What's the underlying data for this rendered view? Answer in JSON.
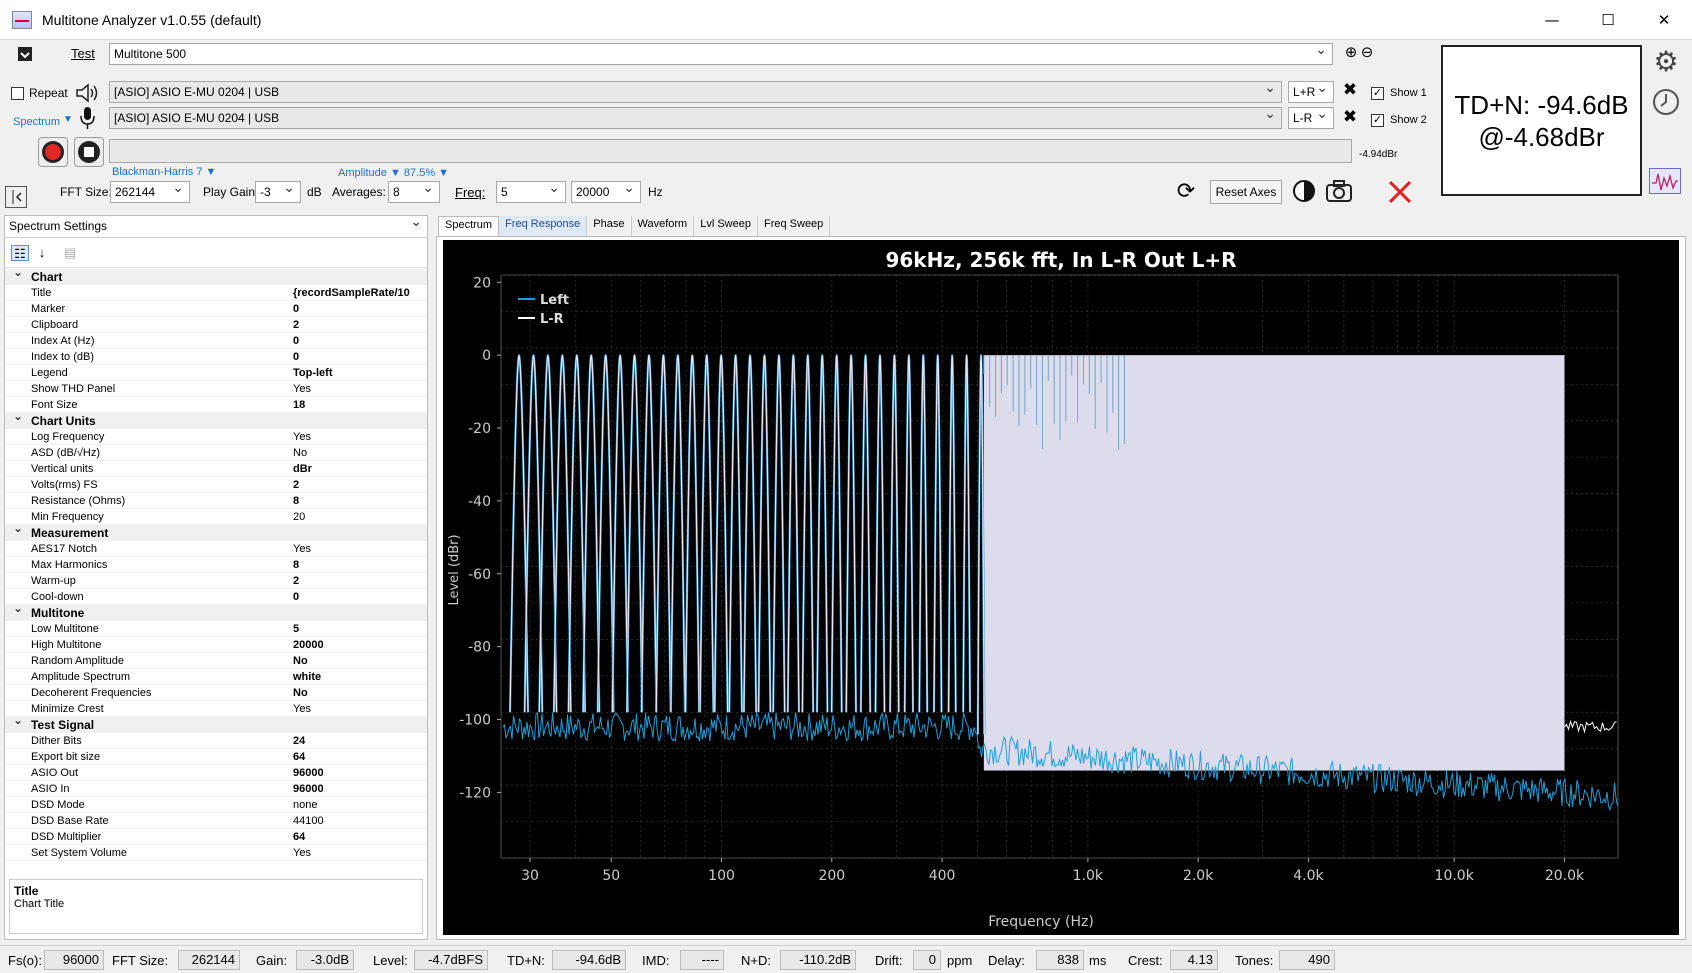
{
  "window": {
    "title": "Multitone Analyzer v1.0.55 (default)",
    "min": "—",
    "max": "☐",
    "close": "✕"
  },
  "toolbar": {
    "test_label": "Test",
    "test_value": "Multitone 500",
    "repeat_label": "Repeat",
    "mode_label": "Spectrum",
    "output_device": "[ASIO] ASIO E-MU 0204 | USB",
    "input_device": "[ASIO] ASIO E-MU 0204 | USB",
    "output_channel": "L+R",
    "input_channel": "L-R",
    "show1_label": "Show 1",
    "show2_label": "Show 2",
    "level_readout": "-4.94dBr",
    "window_func": "Blackman-Harris 7 ▼",
    "amplitude_label": "Amplitude ▼ 87.5% ▼",
    "fft_size_label": "FFT Size:",
    "fft_size_value": "262144",
    "play_gain_label": "Play Gain:",
    "play_gain_value": "-3",
    "play_gain_unit": "dB",
    "averages_label": "Averages:",
    "averages_value": "8",
    "freq_label": "Freq:",
    "freq_low": "5",
    "freq_high": "20000",
    "freq_unit": "Hz",
    "reset_axes": "Reset Axes"
  },
  "result": {
    "line1": "TD+N: -94.6dB",
    "line2": "@-4.68dBr"
  },
  "settings_panel": {
    "header": "Spectrum Settings",
    "categories": [
      {
        "name": "Chart",
        "rows": [
          [
            "Title",
            "{recordSampleRate/10",
            true
          ],
          [
            "Marker",
            "0",
            true
          ],
          [
            "Clipboard",
            "2",
            true
          ],
          [
            "Index At (Hz)",
            "0",
            true
          ],
          [
            "Index to (dB)",
            "0",
            true
          ],
          [
            "Legend",
            "Top-left",
            true
          ],
          [
            "Show THD Panel",
            "Yes",
            false
          ],
          [
            "Font Size",
            "18",
            true
          ]
        ]
      },
      {
        "name": "Chart Units",
        "rows": [
          [
            "Log Frequency",
            "Yes",
            false
          ],
          [
            "ASD (dB/√Hz)",
            "No",
            false
          ],
          [
            "Vertical units",
            "dBr",
            true
          ],
          [
            "Volts(rms) FS",
            "2",
            true
          ],
          [
            "Resistance (Ohms)",
            "8",
            true
          ],
          [
            "Min Frequency",
            "20",
            false
          ]
        ]
      },
      {
        "name": "Measurement",
        "rows": [
          [
            "AES17 Notch",
            "Yes",
            false
          ],
          [
            "Max Harmonics",
            "8",
            true
          ],
          [
            "Warm-up",
            "2",
            true
          ],
          [
            "Cool-down",
            "0",
            true
          ]
        ]
      },
      {
        "name": "Multitone",
        "rows": [
          [
            "Low Multitone",
            "5",
            true
          ],
          [
            "High Multitone",
            "20000",
            true
          ],
          [
            "Random Amplitude",
            "No",
            true
          ],
          [
            "Amplitude Spectrum",
            "white",
            true
          ],
          [
            "Decoherent Frequencies",
            "No",
            true
          ],
          [
            "Minimize Crest",
            "Yes",
            false
          ]
        ]
      },
      {
        "name": "Test Signal",
        "rows": [
          [
            "Dither Bits",
            "24",
            true
          ],
          [
            "Export bit size",
            "64",
            true
          ],
          [
            "ASIO Out",
            "96000",
            true
          ],
          [
            "ASIO In",
            "96000",
            true
          ],
          [
            "DSD Mode",
            "none",
            false
          ],
          [
            "DSD Base Rate",
            "44100",
            false
          ],
          [
            "DSD Multiplier",
            "64",
            true
          ],
          [
            "Set System Volume",
            "Yes",
            false
          ]
        ]
      }
    ],
    "desc_title": "Title",
    "desc_text": "Chart Title"
  },
  "tabs": [
    "Spectrum",
    "Freq Response",
    "Phase",
    "Waveform",
    "Lvl Sweep",
    "Freq Sweep"
  ],
  "chart_data": {
    "type": "line",
    "title": "96kHz, 256k fft, In L-R  Out L+R",
    "xlabel": "Frequency (Hz)",
    "ylabel": "Level (dBr)",
    "x_scale": "log",
    "xlim": [
      25,
      28000
    ],
    "ylim": [
      -138,
      22
    ],
    "x_ticks": [
      30,
      50,
      100,
      200,
      400,
      1000,
      2000,
      4000,
      10000,
      20000
    ],
    "x_tick_labels": [
      "30",
      "50",
      "100",
      "200",
      "400",
      "1.0k",
      "2.0k",
      "4.0k",
      "10.0k",
      "20.0k"
    ],
    "y_ticks": [
      20,
      0,
      -20,
      -40,
      -60,
      -80,
      -100,
      -120
    ],
    "legend_position": "top-left",
    "series": [
      {
        "name": "Left",
        "color": "#1f9fd8"
      },
      {
        "name": "L-R",
        "color": "#ffffff"
      }
    ],
    "tone_band": {
      "x": [
        5,
        20000
      ],
      "peak_db": 0,
      "noise_floor_db": -104
    },
    "outside_floor_db": -104,
    "dense_above_hz": 520,
    "colors": {
      "background": "#000000",
      "fill": "#dcdcec",
      "grid": "#3a3a3a"
    }
  },
  "status": {
    "fs_label": "Fs(o):",
    "fs": "96000",
    "fft_label": "FFT Size:",
    "fft": "262144",
    "gain_label": "Gain:",
    "gain": "-3.0dB",
    "level_label": "Level:",
    "level": "-4.7dBFS",
    "tdn_label": "TD+N:",
    "tdn": "-94.6dB",
    "imd_label": "IMD:",
    "imd": "----",
    "nd_label": "N+D:",
    "nd": "-110.2dB",
    "drift_label": "Drift:",
    "drift": "0",
    "drift_unit": "ppm",
    "delay_label": "Delay:",
    "delay": "838",
    "delay_unit": "ms",
    "crest_label": "Crest:",
    "crest": "4.13",
    "tones_label": "Tones:",
    "tones": "490"
  }
}
